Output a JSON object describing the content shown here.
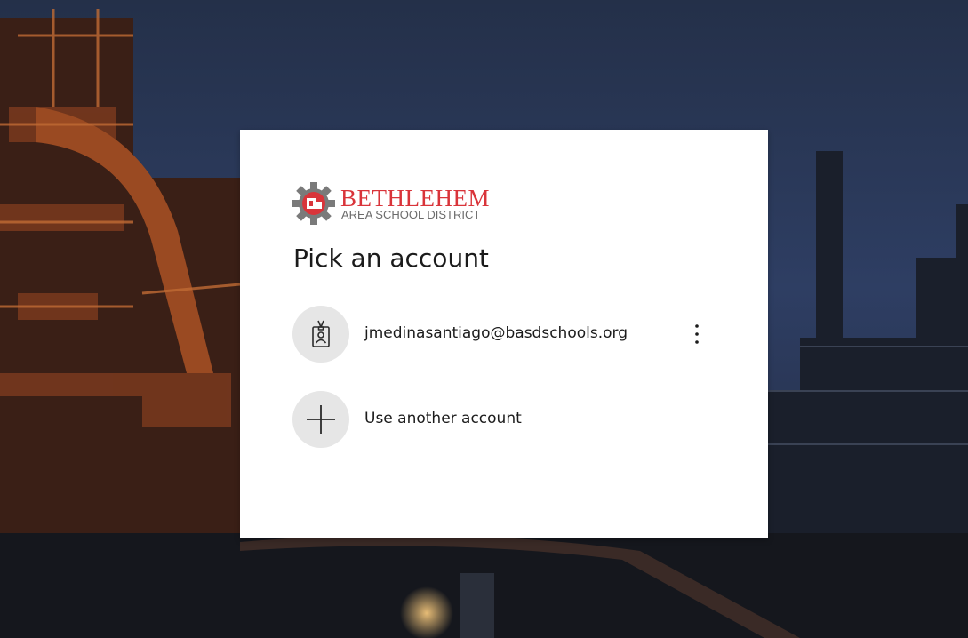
{
  "brand": {
    "name": "BETHLEHEM",
    "subtitle": "AREA SCHOOL DISTRICT",
    "accent_color": "#d9343a",
    "logo_icon": "gear-logo-icon"
  },
  "title": "Pick an account",
  "accounts": [
    {
      "email": "jmedinasantiago@basdschools.org",
      "icon": "badge-icon",
      "menu_icon": "more-options-icon"
    }
  ],
  "other_account": {
    "label": "Use another account",
    "icon": "plus-icon"
  }
}
